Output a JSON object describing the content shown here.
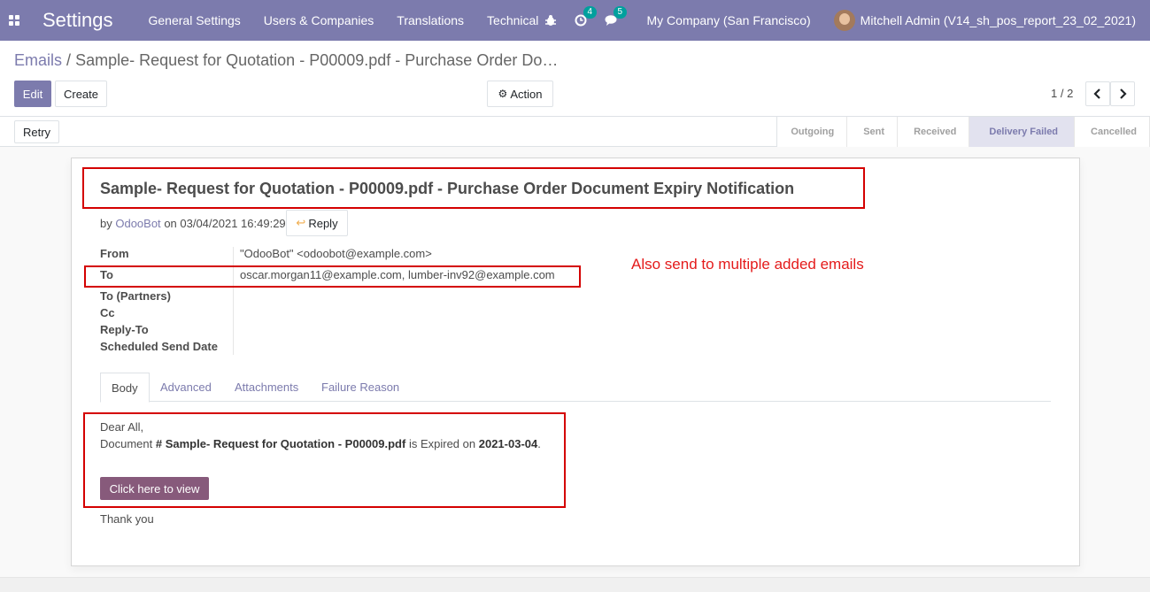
{
  "navbar": {
    "app_title": "Settings",
    "menu": [
      "General Settings",
      "Users & Companies",
      "Translations",
      "Technical"
    ],
    "activity_count": "4",
    "messages_count": "5",
    "company": "My Company (San Francisco)",
    "user": "Mitchell Admin (V14_sh_pos_report_23_02_2021)",
    "bg_color": "#7c7bad"
  },
  "breadcrumb": {
    "parent": "Emails",
    "separator": "/",
    "current": "Sample- Request for Quotation - P00009.pdf - Purchase Order Do…"
  },
  "buttons": {
    "edit": "Edit",
    "create": "Create",
    "action": "Action",
    "retry": "Retry"
  },
  "pager": {
    "value": "1 / 2"
  },
  "stages": [
    "Outgoing",
    "Sent",
    "Received",
    "Delivery Failed",
    "Cancelled"
  ],
  "active_stage": "Delivery Failed",
  "mail": {
    "subject": "Sample- Request for Quotation - P00009.pdf - Purchase Order Document Expiry Notification",
    "by_prefix": "by",
    "author": "OdooBot",
    "date_text": "on 03/04/2021 16:49:29",
    "reply_label": "Reply",
    "fields": {
      "from_label": "From",
      "from_value": "\"OdooBot\" <odoobot@example.com>",
      "to_label": "To",
      "to_value": "oscar.morgan11@example.com, lumber-inv92@example.com",
      "to_partners_label": "To (Partners)",
      "cc_label": "Cc",
      "reply_to_label": "Reply-To",
      "scheduled_label": "Scheduled Send Date"
    },
    "note": "Also send to multiple added emails",
    "tabs": [
      "Body",
      "Advanced",
      "Attachments",
      "Failure Reason"
    ],
    "body": {
      "greeting": "Dear All,",
      "doc_prefix": "Document",
      "doc_name": "# Sample- Request for Quotation - P00009.pdf",
      "doc_middle": "is Expired on",
      "doc_date": "2021-03-04",
      "doc_end": ".",
      "view_button": "Click here to view",
      "thanks": "Thank you"
    }
  }
}
